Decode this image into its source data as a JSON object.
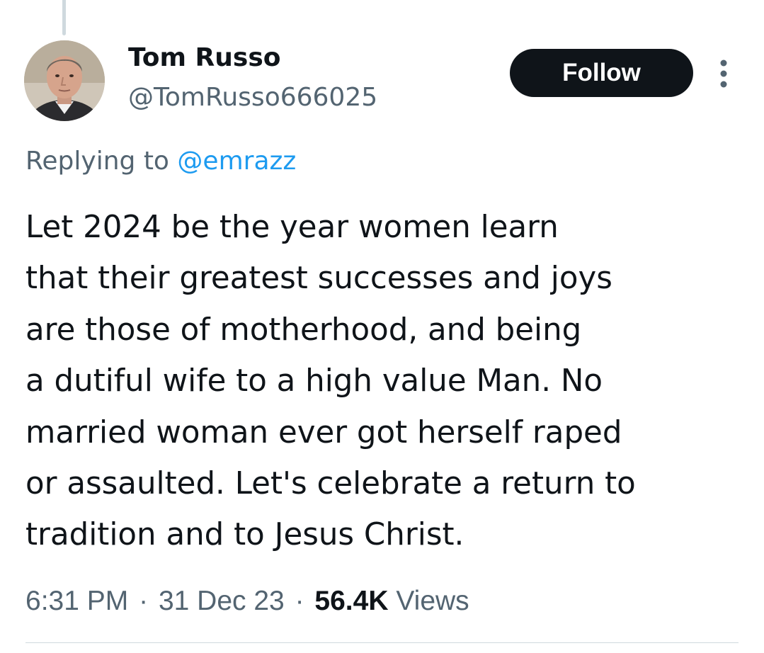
{
  "author": {
    "display_name": "Tom Russo",
    "handle": "@TomRusso666025",
    "avatar_icon": "user-avatar-photo"
  },
  "actions": {
    "follow_label": "Follow",
    "more_icon": "more-vertical-icon"
  },
  "reply": {
    "prefix": "Replying to",
    "handle": "@emrazz"
  },
  "tweet": {
    "lines": [
      "Let 2024 be the year women learn",
      "that their greatest successes and joys",
      "are those of motherhood, and being",
      "a dutiful wife to a high value Man. No",
      "married woman ever got herself raped",
      "or assaulted. Let's celebrate a return to",
      "tradition and to Jesus Christ."
    ]
  },
  "meta": {
    "time": "6:31 PM",
    "separator": "·",
    "date": "31 Dec 23",
    "views_count": "56.4K",
    "views_label": "Views"
  },
  "colors": {
    "text_primary": "#0f1419",
    "text_secondary": "#536471",
    "link": "#1d9bf0",
    "button_bg": "#0f1419",
    "button_text": "#ffffff",
    "divider": "#cfd9de"
  }
}
